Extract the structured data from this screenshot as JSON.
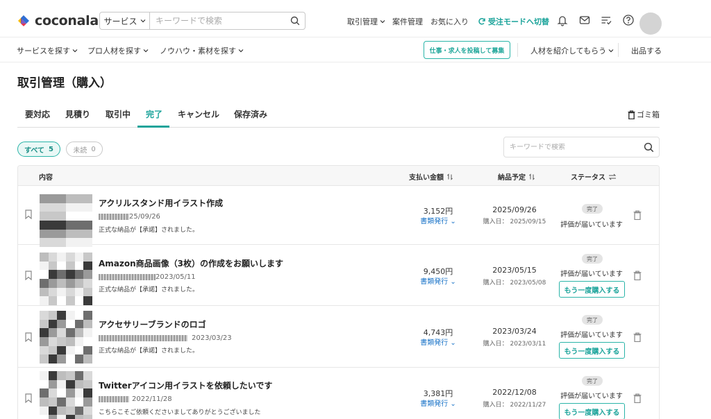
{
  "header": {
    "logo_text": "coconala",
    "search_category": "サービス",
    "search_placeholder": "キーワードで検索",
    "nav": {
      "transactions": "取引管理",
      "projects": "案件管理",
      "favorites": "お気に入り",
      "switch_mode": "受注モードへ切替"
    },
    "accent_color": "#1aa39a"
  },
  "subnav": {
    "find_service": "サービスを探す",
    "find_pro": "プロ人材を探す",
    "find_knowhow": "ノウハウ・素材を探す",
    "post_job": "仕事・求人を投稿して募集",
    "introduce": "人材を紹介してもらう",
    "sell": "出品する"
  },
  "page": {
    "title": "取引管理（購入）",
    "tabs": [
      "要対応",
      "見積り",
      "取引中",
      "完了",
      "キャンセル",
      "保存済み"
    ],
    "active_tab": "完了",
    "trash_label": "ゴミ箱",
    "filter_all_label": "すべて",
    "filter_all_count": "5",
    "filter_unread_label": "未読",
    "filter_unread_count": "0",
    "list_search_placeholder": "キーワードで検索"
  },
  "table": {
    "headers": {
      "content": "内容",
      "amount": "支払い金額",
      "delivery": "納品予定",
      "status": "ステータス"
    },
    "rows": [
      {
        "title": "アクリルスタンド用イラスト作成",
        "date": "25/09/26",
        "message": "正式な納品が【承諾】されました。",
        "amount": "3,152円",
        "docs": "書類発行",
        "delivery_date": "2025/09/26",
        "purchase_date": "購入日： 2025/09/15",
        "badge": "完了",
        "review": "評価が届いています",
        "rebuy": ""
      },
      {
        "title": "Amazon商品画像（3枚）の作成をお願いします",
        "date": "2023/05/11",
        "message": "正式な納品が【承諾】されました。",
        "amount": "9,450円",
        "docs": "書類発行",
        "delivery_date": "2023/05/15",
        "purchase_date": "購入日： 2023/05/08",
        "badge": "完了",
        "review": "評価が届いています",
        "rebuy": "もう一度購入する"
      },
      {
        "title": "アクセサリーブランドのロゴ",
        "date": "2023/03/23",
        "message": "正式な納品が【承諾】されました。",
        "amount": "4,743円",
        "docs": "書類発行",
        "delivery_date": "2023/03/24",
        "purchase_date": "購入日： 2023/03/11",
        "badge": "完了",
        "review": "評価が届いています",
        "rebuy": "もう一度購入する"
      },
      {
        "title": "Twitterアイコン用イラストを依頼したいです",
        "date": "2022/11/28",
        "message": "こちらこそご依頼くださいましてありがとうございました",
        "amount": "3,381円",
        "docs": "書類発行",
        "delivery_date": "2022/12/08",
        "purchase_date": "購入日： 2022/11/27",
        "badge": "完了",
        "review": "評価が届いています",
        "rebuy": "もう一度購入する"
      }
    ]
  }
}
